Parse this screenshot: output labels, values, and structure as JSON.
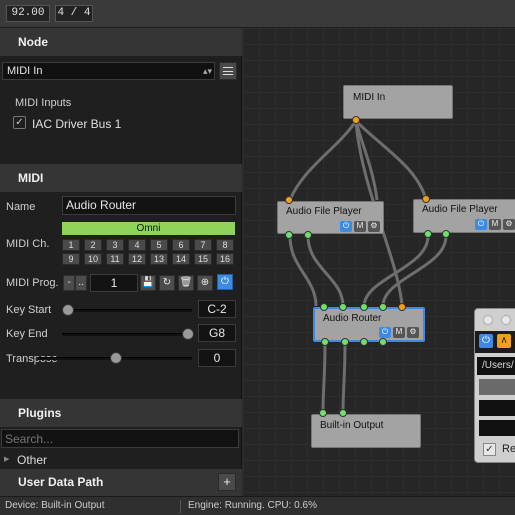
{
  "toolbar": {
    "tempo": "92.00",
    "time_signature": "4 / 4"
  },
  "node_section": {
    "title": "Node",
    "selected": "MIDI In",
    "inputs_label": "MIDI Inputs",
    "input_device": "IAC Driver Bus 1"
  },
  "midi_section": {
    "title": "MIDI",
    "name_label": "Name",
    "name_value": "Audio Router",
    "channel_label": "MIDI Ch.",
    "omni_label": "Omni",
    "channels": [
      "1",
      "2",
      "3",
      "4",
      "5",
      "6",
      "7",
      "8",
      "9",
      "10",
      "11",
      "12",
      "13",
      "14",
      "15",
      "16"
    ],
    "program_label": "MIDI Prog.",
    "program_minus": "-",
    "program_dots": "..",
    "program_value": "1",
    "key_start_label": "Key Start",
    "key_start_value": "C-2",
    "key_end_label": "Key End",
    "key_end_value": "G8",
    "transpose_label": "Transpose",
    "transpose_value": "0",
    "key_start_level": 0.0,
    "key_end_level": 1.0,
    "transpose_level": 0.5
  },
  "plugins_section": {
    "title": "Plugins",
    "search_placeholder": "Search...",
    "tree_item": "Other"
  },
  "user_data": {
    "title": "User Data Path",
    "add": "+"
  },
  "graph": {
    "nodes": {
      "midi_in": "MIDI In",
      "player1": "Audio File Player",
      "player2": "Audio File Player",
      "router": "Audio Router",
      "output": "Built-in Output"
    },
    "mute_label": "M"
  },
  "popup": {
    "path": "/Users/",
    "label": "Re"
  },
  "status": {
    "device": "Device: Built-in Output",
    "engine": "Engine: Running.  CPU: 0.6%"
  },
  "colors": {
    "accent": "#3d8be0",
    "omni": "#8fd35a",
    "port_in": "#f0a01c",
    "port_out": "#6fe06f"
  }
}
